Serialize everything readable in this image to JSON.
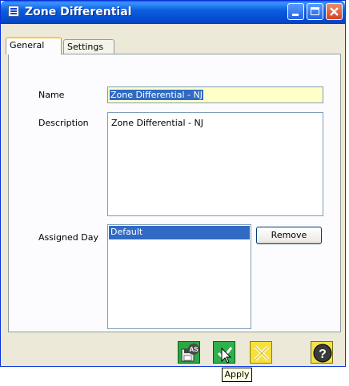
{
  "window": {
    "title": "Zone Differential"
  },
  "tabs": [
    {
      "label": "General",
      "active": true
    },
    {
      "label": "Settings",
      "active": false
    }
  ],
  "form": {
    "name_label": "Name",
    "name_value": "Zone Differential - NJ",
    "description_label": "Description",
    "description_value": "Zone Differential - NJ",
    "assigned_day_label": "Assigned Day",
    "assigned_days": [
      "Default"
    ],
    "remove_label": "Remove"
  },
  "toolbar": {
    "save_as_badge": "AS",
    "apply_tooltip": "Apply",
    "icons": [
      "save-as-icon",
      "apply-icon",
      "cancel-icon",
      "help-icon"
    ]
  },
  "colors": {
    "titlebar": "#0a5fe0",
    "selection": "#316ac5",
    "name_field_bg": "#ffffc8",
    "tab_highlight": "#ffc83c"
  }
}
